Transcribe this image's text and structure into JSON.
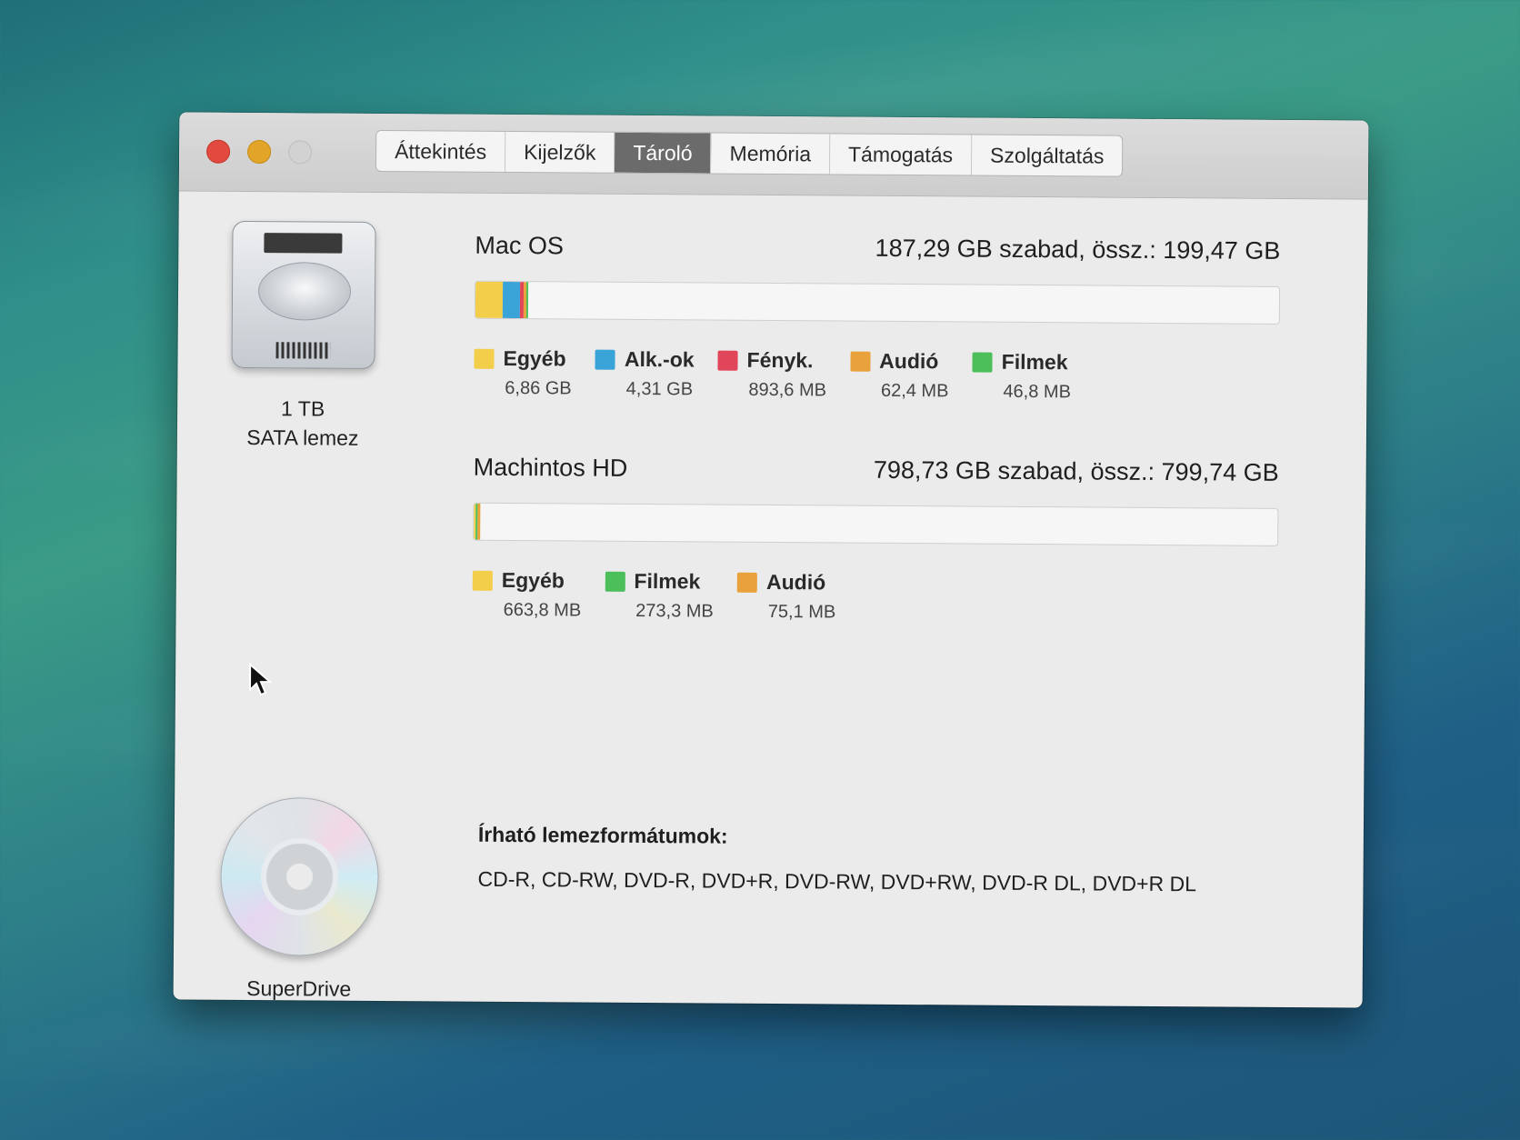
{
  "window": {
    "tabs": [
      {
        "label": "Áttekintés",
        "active": false
      },
      {
        "label": "Kijelzők",
        "active": false
      },
      {
        "label": "Tároló",
        "active": true
      },
      {
        "label": "Memória",
        "active": false
      },
      {
        "label": "Támogatás",
        "active": false
      },
      {
        "label": "Szolgáltatás",
        "active": false
      }
    ]
  },
  "devices": {
    "disk": {
      "icon": "hard-drive-icon",
      "line1": "1 TB",
      "line2": "SATA lemez"
    },
    "optical": {
      "icon": "cd-disc-icon",
      "label": "SuperDrive"
    }
  },
  "volumes": [
    {
      "name": "Mac OS",
      "free": "187,29 GB szabad, össz.: 199,47 GB",
      "usage_segments": [
        {
          "category": "Egyéb",
          "fraction": 0.034,
          "color": "#f2ce4b"
        },
        {
          "category": "Alk.-ok",
          "fraction": 0.022,
          "color": "#3aa4d9"
        },
        {
          "category": "Fényk.",
          "fraction": 0.0045,
          "color": "#e0455a"
        },
        {
          "category": "Audió",
          "fraction": 0.0003,
          "color": "#e9a23b"
        },
        {
          "category": "Filmek",
          "fraction": 0.0002,
          "color": "#4cbf5b"
        }
      ],
      "legend": [
        {
          "name": "Egyéb",
          "size": "6,86 GB",
          "color": "#f2ce4b"
        },
        {
          "name": "Alk.-ok",
          "size": "4,31 GB",
          "color": "#3aa4d9"
        },
        {
          "name": "Fényk.",
          "size": "893,6 MB",
          "color": "#e0455a"
        },
        {
          "name": "Audió",
          "size": "62,4 MB",
          "color": "#e9a23b"
        },
        {
          "name": "Filmek",
          "size": "46,8 MB",
          "color": "#4cbf5b"
        }
      ]
    },
    {
      "name": "Machintos HD",
      "free": "798,73 GB szabad, össz.: 799,74 GB",
      "usage_segments": [
        {
          "category": "Egyéb",
          "fraction": 0.0008,
          "color": "#f2ce4b"
        },
        {
          "category": "Filmek",
          "fraction": 0.0003,
          "color": "#4cbf5b"
        },
        {
          "category": "Audió",
          "fraction": 0.0001,
          "color": "#e9a23b"
        }
      ],
      "legend": [
        {
          "name": "Egyéb",
          "size": "663,8 MB",
          "color": "#f2ce4b"
        },
        {
          "name": "Filmek",
          "size": "273,3 MB",
          "color": "#4cbf5b"
        },
        {
          "name": "Audió",
          "size": "75,1 MB",
          "color": "#e9a23b"
        }
      ]
    }
  ],
  "writable_formats": {
    "title": "Írható lemezformátumok:",
    "list": "CD-R, CD-RW, DVD-R, DVD+R, DVD-RW, DVD+RW, DVD-R DL, DVD+R DL"
  }
}
